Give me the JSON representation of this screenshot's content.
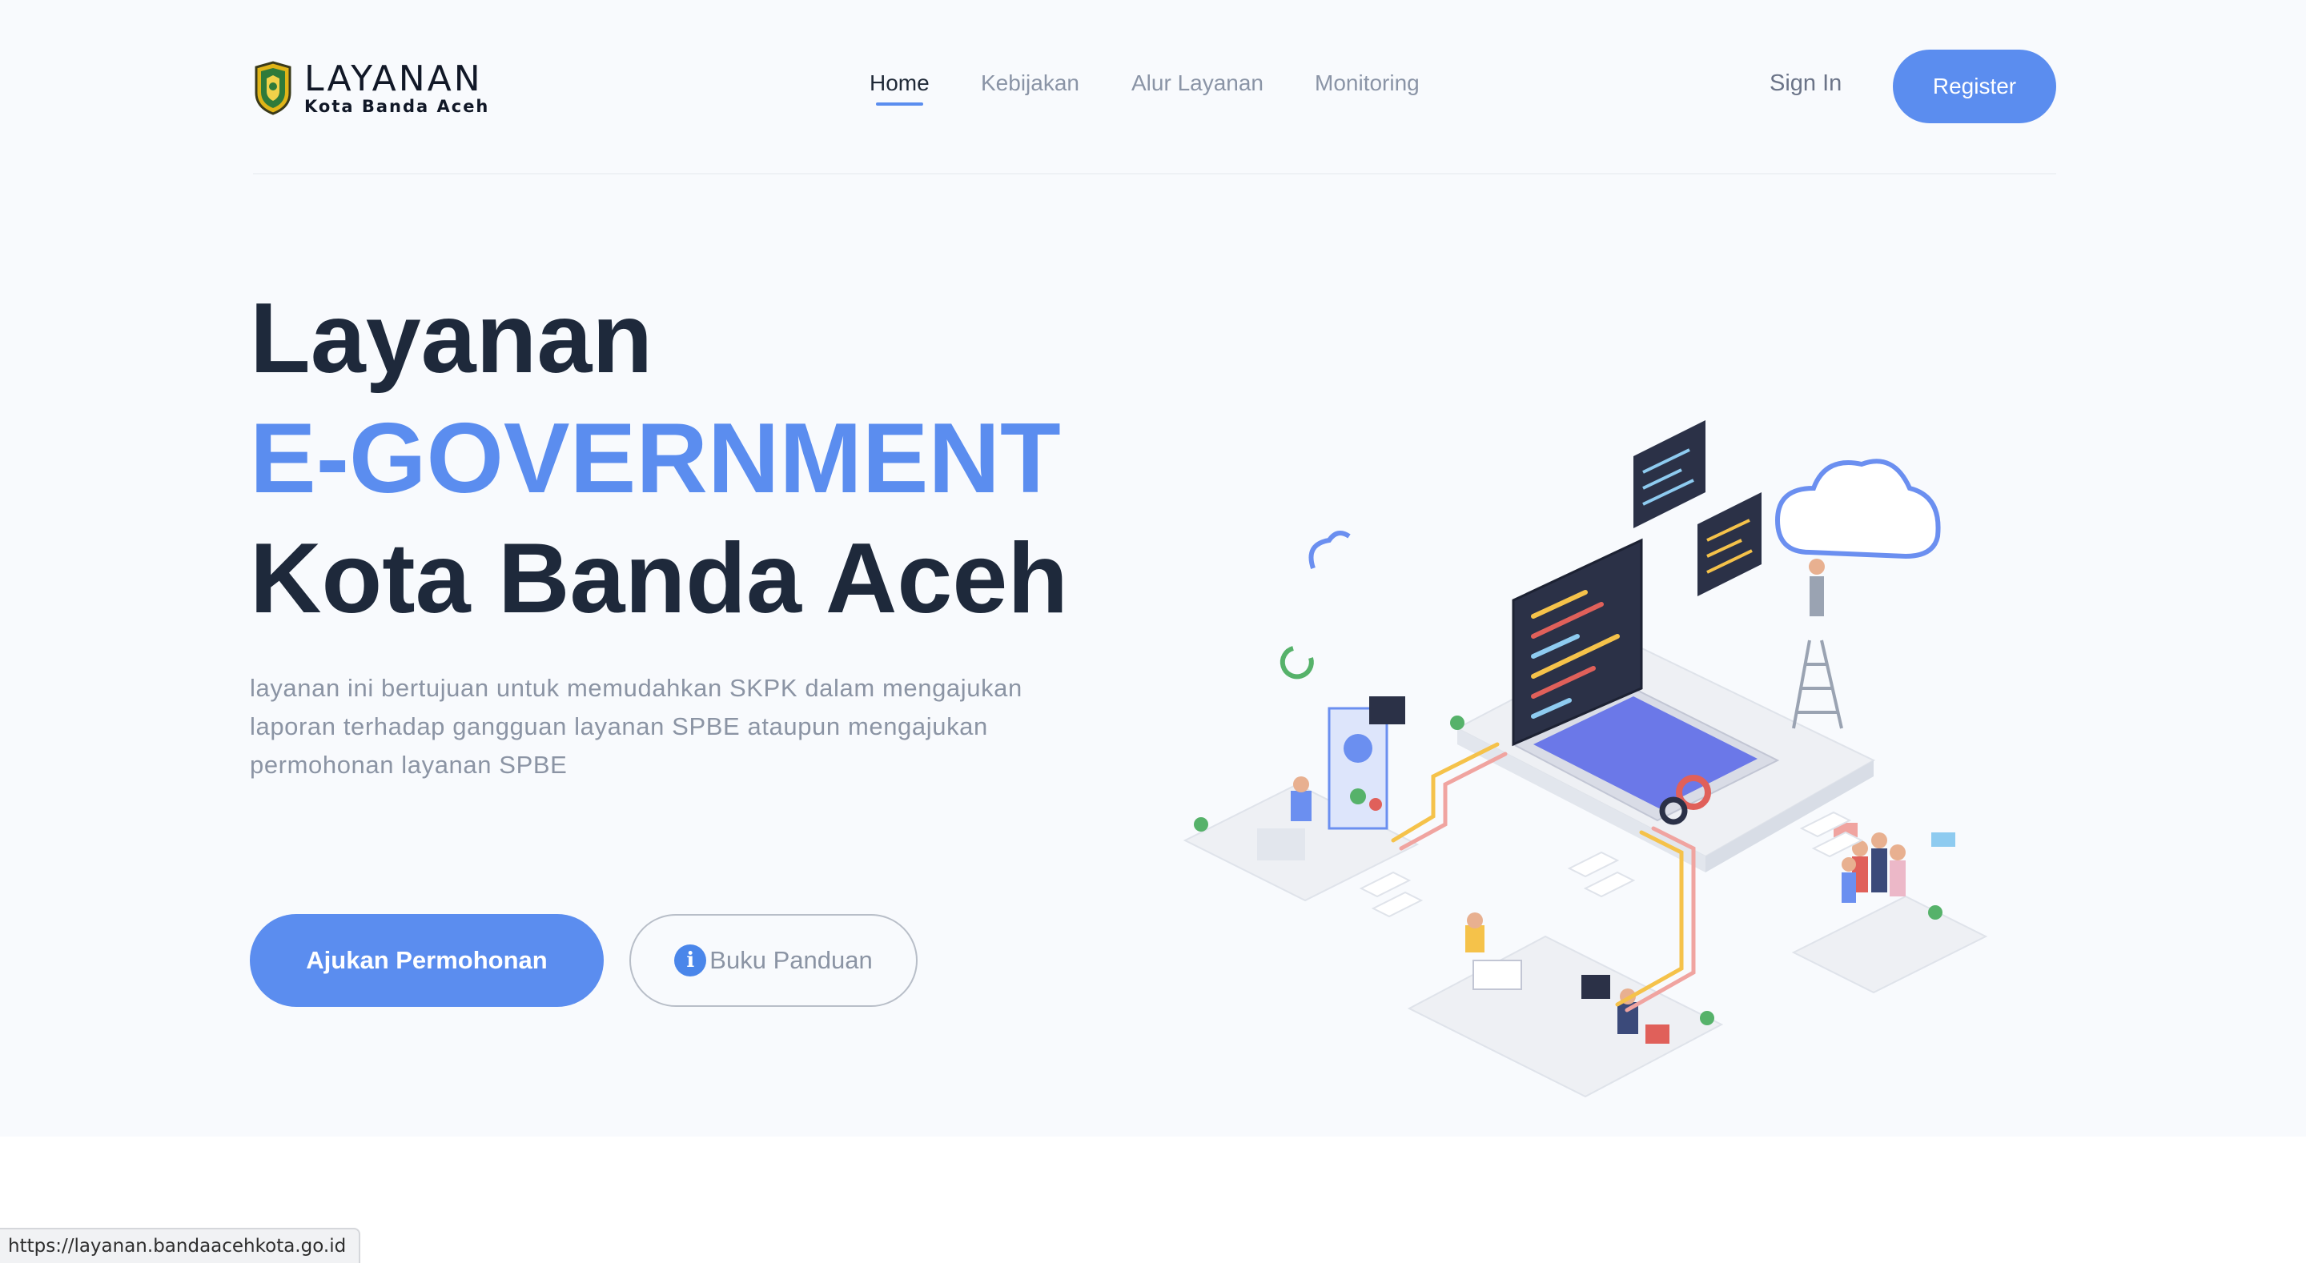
{
  "header": {
    "logo_title": "LAYANAN",
    "logo_subtitle": "Kota Banda Aceh",
    "nav": [
      {
        "label": "Home",
        "active": true
      },
      {
        "label": "Kebijakan",
        "active": false
      },
      {
        "label": "Alur Layanan",
        "active": false
      },
      {
        "label": "Monitoring",
        "active": false
      }
    ],
    "signin_label": "Sign In",
    "register_label": "Register"
  },
  "hero": {
    "line1": "Layanan",
    "line2": "E-GOVERNMENT",
    "line3": "Kota Banda Aceh",
    "description": "layanan ini bertujuan untuk memudahkan SKPK dalam mengajukan laporan terhadap gangguan layanan SPBE ataupun mengajukan permohonan layanan SPBE",
    "primary_button": "Ajukan Permohonan",
    "secondary_button": "Buku Panduan",
    "secondary_icon": "info-icon"
  },
  "status_bar": {
    "url": "https://layanan.bandaacehkota.go.id"
  },
  "colors": {
    "accent": "#5b8def",
    "heading": "#1e293b",
    "muted": "#8b94a4",
    "background": "#f8fafd"
  }
}
